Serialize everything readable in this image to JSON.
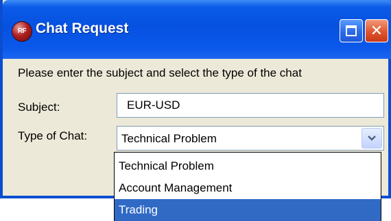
{
  "window": {
    "icon_text": "RF",
    "title": "Chat Request"
  },
  "form": {
    "instructions": "Please enter the subject and select the type of the chat",
    "subject_label": "Subject:",
    "subject_value": "EUR-USD",
    "type_label": "Type of Chat:",
    "type_value": "Technical Problem",
    "options": [
      "Technical Problem",
      "Account Management",
      "Trading"
    ],
    "highlighted_option": "Trading"
  },
  "colors": {
    "titlebar": "#0651e0",
    "window_bg": "#ece9d8",
    "selection": "#316ac5",
    "close_button": "#e0552e"
  }
}
